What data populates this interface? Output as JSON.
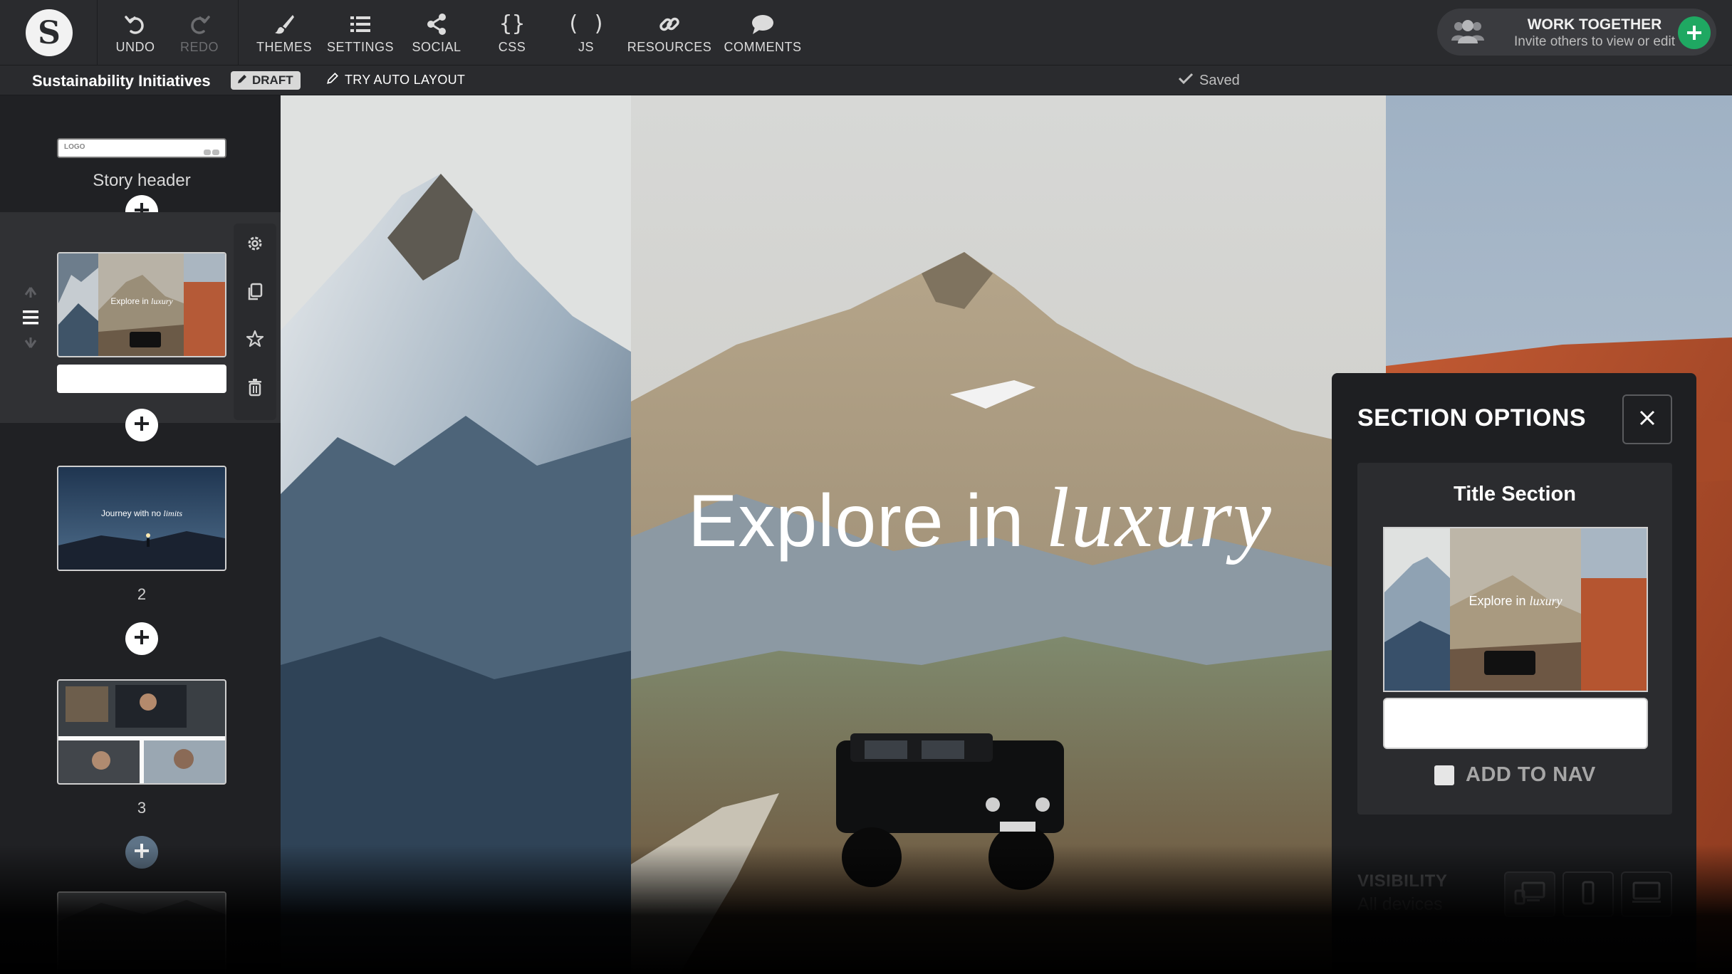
{
  "app": {
    "logo_letter": "S"
  },
  "toolbar": {
    "undo": "UNDO",
    "redo": "REDO",
    "themes": "THEMES",
    "settings": "SETTINGS",
    "social": "SOCIAL",
    "css": "CSS",
    "js": "JS",
    "resources": "RESOURCES",
    "comments": "COMMENTS"
  },
  "collab": {
    "title": "WORK TOGETHER",
    "subtitle": "Invite others to view or edit"
  },
  "subbar": {
    "story_title": "Sustainability Initiatives",
    "draft": "DRAFT",
    "auto_layout": "TRY AUTO LAYOUT",
    "saved": "Saved"
  },
  "sidebar": {
    "header_logo": "LOGO",
    "header_label": "Story header",
    "sections": [
      {
        "thumb_text_plain": "Explore in",
        "thumb_text_italic": "luxury",
        "number": ""
      },
      {
        "thumb_text_plain": "Journey with no",
        "thumb_text_italic": "limits",
        "number": "2"
      },
      {
        "number": "3"
      }
    ]
  },
  "hero": {
    "plain": "Explore in",
    "italic": "luxury"
  },
  "panel": {
    "title": "SECTION OPTIONS",
    "card_title": "Title Section",
    "thumb_plain": "Explore in",
    "thumb_italic": "luxury",
    "add_to_nav": "ADD TO NAV",
    "add_to_nav_checked": false,
    "visibility_label": "VISIBILITY",
    "visibility_value": "All devices"
  },
  "colors": {
    "accent_green": "#1fa862",
    "toolbar_bg": "#2a2b2e",
    "panel_bg": "#1e1f22"
  }
}
